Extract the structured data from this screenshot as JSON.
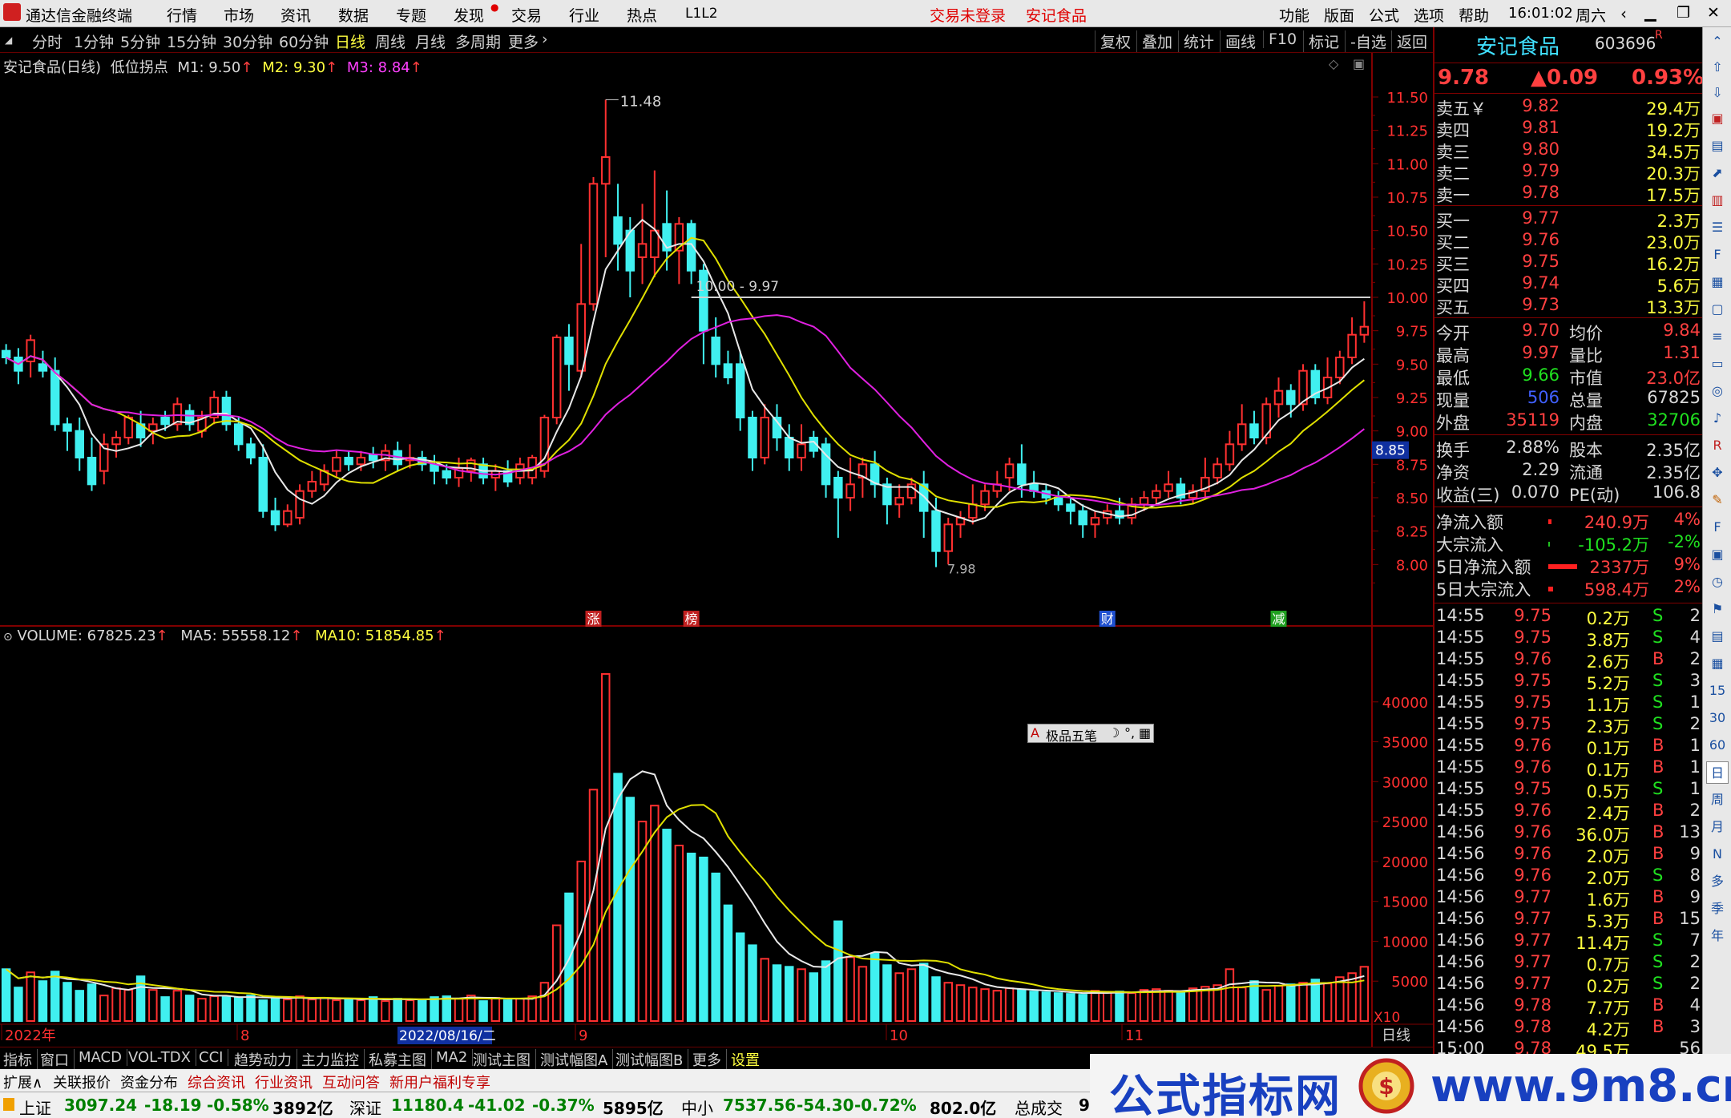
{
  "titlebar": {
    "app": "通达信金融终端",
    "menu": [
      "行情",
      "市场",
      "资讯",
      "数据",
      "专题",
      "发现",
      "交易",
      "行业",
      "热点",
      "L1L2"
    ],
    "trade_status": "交易未登录",
    "stock_name": "安记食品",
    "right_menu": [
      "功能",
      "版面",
      "公式",
      "选项",
      "帮助"
    ],
    "time": "16:01:02",
    "weekday": "周六"
  },
  "periods": [
    "分时",
    "1分钟",
    "5分钟",
    "15分钟",
    "30分钟",
    "60分钟",
    "日线",
    "周线",
    "月线",
    "多周期",
    "更多"
  ],
  "tools": [
    "复权",
    "叠加",
    "统计",
    "画线",
    "F10",
    "标记",
    "-自选",
    "返回"
  ],
  "kline_info": {
    "name": "安记食品(日线)",
    "indicator": "低位拐点",
    "m1": "M1: 9.50",
    "m2": "M2: 9.30",
    "m3": "M3: 8.84"
  },
  "volume_info": {
    "volume": "VOLUME: 67825.23",
    "ma5": "MA5: 55558.12",
    "ma10": "MA10: 51854.85"
  },
  "price_axis": [
    "11.50",
    "11.25",
    "11.00",
    "10.75",
    "10.50",
    "10.25",
    "10.00",
    "9.75",
    "9.50",
    "9.25",
    "9.00",
    "8.75",
    "8.50",
    "8.25",
    "8.00"
  ],
  "price_tag": "8.85",
  "vol_axis": [
    "40000",
    "35000",
    "30000",
    "25000",
    "20000",
    "15000",
    "10000",
    "5000"
  ],
  "vol_unit": "X10",
  "annotations": {
    "high": "11.48",
    "low": "7.98",
    "line": "10.00 - 9.97"
  },
  "markers": [
    "涨",
    "榜",
    "财",
    "减"
  ],
  "date_axis": {
    "start": "2022年",
    "m8": "8",
    "current": "2022/08/16/二",
    "m9": "9",
    "m10": "10",
    "m11": "11",
    "period": "日线"
  },
  "ime": "极品五笔",
  "chart_data": {
    "type": "candlestick",
    "ylim": [
      8.0,
      11.5
    ],
    "series": [
      "K线",
      "M1",
      "M2",
      "M3",
      "VOLUME",
      "MA5",
      "MA10"
    ],
    "candles": [
      [
        9.6,
        9.55,
        9.65,
        9.5
      ],
      [
        9.55,
        9.45,
        9.62,
        9.35
      ],
      [
        9.52,
        9.68,
        9.72,
        9.4
      ],
      [
        9.5,
        9.45,
        9.6,
        9.4
      ],
      [
        9.45,
        9.05,
        9.55,
        9.0
      ],
      [
        9.05,
        9.0,
        9.1,
        8.85
      ],
      [
        9.0,
        8.8,
        9.1,
        8.7
      ],
      [
        8.8,
        8.6,
        8.95,
        8.55
      ],
      [
        8.7,
        8.9,
        8.98,
        8.6
      ],
      [
        8.9,
        8.95,
        9.0,
        8.8
      ],
      [
        8.95,
        9.1,
        9.12,
        8.9
      ],
      [
        9.05,
        8.95,
        9.15,
        8.88
      ],
      [
        9.0,
        9.05,
        9.1,
        8.9
      ],
      [
        9.1,
        9.05,
        9.15,
        9.0
      ],
      [
        9.05,
        9.2,
        9.25,
        9.0
      ],
      [
        9.15,
        9.05,
        9.2,
        9.0
      ],
      [
        9.0,
        9.1,
        9.15,
        8.95
      ],
      [
        9.1,
        9.25,
        9.3,
        9.05
      ],
      [
        9.25,
        9.05,
        9.3,
        9.0
      ],
      [
        9.05,
        8.9,
        9.1,
        8.85
      ],
      [
        8.9,
        8.8,
        8.95,
        8.75
      ],
      [
        8.8,
        8.4,
        8.9,
        8.35
      ],
      [
        8.4,
        8.3,
        8.5,
        8.25
      ],
      [
        8.3,
        8.4,
        8.45,
        8.28
      ],
      [
        8.35,
        8.55,
        8.6,
        8.3
      ],
      [
        8.55,
        8.62,
        8.7,
        8.5
      ],
      [
        8.6,
        8.7,
        8.75,
        8.55
      ],
      [
        8.7,
        8.8,
        8.85,
        8.65
      ],
      [
        8.8,
        8.75,
        8.85,
        8.7
      ],
      [
        8.75,
        8.8,
        8.85,
        8.7
      ],
      [
        8.82,
        8.78,
        8.88,
        8.72
      ],
      [
        8.78,
        8.85,
        8.9,
        8.7
      ],
      [
        8.85,
        8.75,
        8.92,
        8.7
      ],
      [
        8.78,
        8.8,
        8.9,
        8.72
      ],
      [
        8.8,
        8.75,
        8.85,
        8.7
      ],
      [
        8.75,
        8.7,
        8.82,
        8.6
      ],
      [
        8.7,
        8.65,
        8.75,
        8.6
      ],
      [
        8.65,
        8.72,
        8.8,
        8.58
      ],
      [
        8.7,
        8.78,
        8.8,
        8.62
      ],
      [
        8.75,
        8.65,
        8.8,
        8.6
      ],
      [
        8.65,
        8.7,
        8.75,
        8.55
      ],
      [
        8.7,
        8.62,
        8.78,
        8.58
      ],
      [
        8.65,
        8.75,
        8.8,
        8.6
      ],
      [
        8.65,
        8.8,
        8.82,
        8.6
      ],
      [
        8.7,
        9.1,
        9.12,
        8.65
      ],
      [
        9.1,
        9.7,
        9.72,
        9.05
      ],
      [
        9.7,
        9.5,
        9.8,
        9.3
      ],
      [
        9.45,
        9.95,
        10.4,
        9.4
      ],
      [
        9.95,
        10.85,
        10.9,
        9.9
      ],
      [
        10.85,
        11.05,
        11.48,
        10.3
      ],
      [
        10.6,
        10.4,
        10.85,
        10.2
      ],
      [
        10.5,
        10.2,
        10.6,
        10.0
      ],
      [
        10.3,
        10.4,
        10.7,
        10.1
      ],
      [
        10.3,
        10.5,
        10.95,
        10.15
      ],
      [
        10.55,
        10.35,
        10.8,
        10.2
      ],
      [
        10.35,
        10.55,
        10.6,
        10.1
      ],
      [
        10.55,
        10.2,
        10.58,
        10.1
      ],
      [
        10.2,
        9.75,
        10.25,
        9.5
      ],
      [
        9.7,
        9.5,
        9.85,
        9.4
      ],
      [
        9.5,
        9.4,
        9.6,
        9.35
      ],
      [
        9.5,
        9.1,
        9.6,
        9.0
      ],
      [
        9.1,
        8.8,
        9.15,
        8.7
      ],
      [
        8.8,
        9.1,
        9.2,
        8.75
      ],
      [
        9.1,
        8.95,
        9.2,
        8.85
      ],
      [
        8.95,
        8.8,
        9.05,
        8.7
      ],
      [
        8.8,
        8.9,
        9.05,
        8.7
      ],
      [
        8.95,
        8.85,
        9.0,
        8.8
      ],
      [
        8.9,
        8.6,
        8.95,
        8.5
      ],
      [
        8.65,
        8.5,
        8.7,
        8.2
      ],
      [
        8.5,
        8.6,
        8.8,
        8.4
      ],
      [
        8.65,
        8.75,
        8.8,
        8.5
      ],
      [
        8.75,
        8.6,
        8.85,
        8.5
      ],
      [
        8.6,
        8.45,
        8.65,
        8.3
      ],
      [
        8.45,
        8.5,
        8.6,
        8.35
      ],
      [
        8.5,
        8.6,
        8.65,
        8.45
      ],
      [
        8.6,
        8.4,
        8.7,
        8.2
      ],
      [
        8.4,
        8.1,
        8.5,
        7.98
      ],
      [
        8.1,
        8.3,
        8.35,
        8.0
      ],
      [
        8.3,
        8.35,
        8.4,
        8.2
      ],
      [
        8.35,
        8.45,
        8.6,
        8.3
      ],
      [
        8.45,
        8.55,
        8.6,
        8.4
      ],
      [
        8.55,
        8.6,
        8.7,
        8.5
      ],
      [
        8.65,
        8.75,
        8.8,
        8.55
      ],
      [
        8.75,
        8.6,
        8.9,
        8.5
      ],
      [
        8.6,
        8.55,
        8.7,
        8.5
      ],
      [
        8.55,
        8.5,
        8.6,
        8.45
      ],
      [
        8.5,
        8.45,
        8.55,
        8.4
      ],
      [
        8.45,
        8.4,
        8.5,
        8.3
      ],
      [
        8.4,
        8.3,
        8.45,
        8.2
      ],
      [
        8.3,
        8.35,
        8.4,
        8.2
      ],
      [
        8.35,
        8.4,
        8.45,
        8.3
      ],
      [
        8.4,
        8.35,
        8.5,
        8.3
      ],
      [
        8.35,
        8.45,
        8.5,
        8.3
      ],
      [
        8.45,
        8.5,
        8.55,
        8.4
      ],
      [
        8.5,
        8.55,
        8.6,
        8.45
      ],
      [
        8.55,
        8.6,
        8.7,
        8.5
      ],
      [
        8.6,
        8.5,
        8.65,
        8.45
      ],
      [
        8.5,
        8.55,
        8.6,
        8.45
      ],
      [
        8.55,
        8.65,
        8.8,
        8.5
      ],
      [
        8.65,
        8.75,
        8.8,
        8.6
      ],
      [
        8.75,
        8.9,
        9.0,
        8.7
      ],
      [
        8.9,
        9.05,
        9.2,
        8.85
      ],
      [
        9.05,
        8.95,
        9.15,
        8.9
      ],
      [
        8.95,
        9.2,
        9.25,
        8.9
      ],
      [
        9.2,
        9.3,
        9.4,
        9.1
      ],
      [
        9.3,
        9.2,
        9.35,
        9.1
      ],
      [
        9.2,
        9.45,
        9.5,
        9.15
      ],
      [
        9.45,
        9.25,
        9.5,
        9.2
      ],
      [
        9.25,
        9.4,
        9.55,
        9.2
      ],
      [
        9.4,
        9.55,
        9.6,
        9.35
      ],
      [
        9.55,
        9.72,
        9.85,
        9.5
      ],
      [
        9.72,
        9.78,
        9.97,
        9.66
      ]
    ],
    "volume": [
      6500,
      4200,
      6100,
      5000,
      6200,
      4800,
      3800,
      4600,
      3200,
      4100,
      3900,
      5600,
      3900,
      3000,
      3800,
      3200,
      2800,
      3100,
      3000,
      2900,
      3200,
      2600,
      3000,
      2700,
      3100,
      2700,
      2900,
      2600,
      2800,
      2600,
      3000,
      2500,
      2800,
      2600,
      2700,
      3000,
      3100,
      2800,
      3200,
      2500,
      2900,
      2600,
      2800,
      3100,
      4800,
      12000,
      16000,
      20000,
      29000,
      43500,
      31000,
      28000,
      25000,
      27000,
      24000,
      22000,
      21000,
      20500,
      18500,
      14500,
      11000,
      9500,
      7800,
      7000,
      6800,
      6500,
      6000,
      7500,
      12500,
      8000,
      6800,
      8500,
      7000,
      6000,
      6500,
      7200,
      5500,
      4800,
      4500,
      4200,
      4000,
      3800,
      4100,
      3900,
      3700,
      3600,
      3500,
      3400,
      3300,
      3800,
      3600,
      3700,
      3500,
      3900,
      4000,
      3800,
      3600,
      4100,
      4300,
      4500,
      6500,
      4200,
      5000,
      3900,
      4400,
      4600,
      4800,
      5200,
      4700,
      5500,
      6000,
      6800
    ],
    "m1_values": "9.50",
    "m2_values": "9.30",
    "m3_values": "8.84"
  },
  "quote": {
    "name": "安记食品",
    "code": "603696",
    "flag": "R",
    "price": "9.78",
    "change": "▲0.09",
    "pct": "0.93%",
    "asks": [
      [
        "卖五￥",
        "9.82",
        "29.4万"
      ],
      [
        "卖四",
        "9.81",
        "19.2万"
      ],
      [
        "卖三",
        "9.80",
        "34.5万"
      ],
      [
        "卖二",
        "9.79",
        "20.3万"
      ],
      [
        "卖一",
        "9.78",
        "17.5万"
      ]
    ],
    "bids": [
      [
        "买一",
        "9.77",
        "2.3万"
      ],
      [
        "买二",
        "9.76",
        "23.0万"
      ],
      [
        "买三",
        "9.75",
        "16.2万"
      ],
      [
        "买四",
        "9.74",
        "5.6万"
      ],
      [
        "买五",
        "9.73",
        "13.3万"
      ]
    ],
    "stats": [
      [
        "今开",
        "9.70",
        "均价",
        "9.84"
      ],
      [
        "最高",
        "9.97",
        "量比",
        "1.31"
      ],
      [
        "最低",
        "9.66",
        "市值",
        "23.0亿"
      ],
      [
        "现量",
        "506",
        "总量",
        "67825"
      ],
      [
        "外盘",
        "35119",
        "内盘",
        "32706"
      ]
    ],
    "fin": [
      [
        "换手",
        "2.88%",
        "股本",
        "2.35亿"
      ],
      [
        "净资",
        "2.29",
        "流通",
        "2.35亿"
      ],
      [
        "收益(三)",
        "0.070",
        "PE(动)",
        "106.8"
      ]
    ],
    "flow": [
      [
        "净流入额",
        "240.9万",
        "4%"
      ],
      [
        "大宗流入",
        "-105.2万",
        "-2%"
      ],
      [
        "5日净流入额",
        "2337万",
        "9%"
      ],
      [
        "5日大宗流入",
        "598.4万",
        "2%"
      ]
    ],
    "ticks": [
      [
        "14:55",
        "9.75",
        "0.2万",
        "S",
        "2"
      ],
      [
        "14:55",
        "9.75",
        "3.8万",
        "S",
        "4"
      ],
      [
        "14:55",
        "9.76",
        "2.6万",
        "B",
        "2"
      ],
      [
        "14:55",
        "9.75",
        "5.2万",
        "S",
        "3"
      ],
      [
        "14:55",
        "9.75",
        "1.1万",
        "S",
        "1"
      ],
      [
        "14:55",
        "9.75",
        "2.3万",
        "S",
        "2"
      ],
      [
        "14:55",
        "9.76",
        "0.1万",
        "B",
        "1"
      ],
      [
        "14:55",
        "9.76",
        "0.1万",
        "B",
        "1"
      ],
      [
        "14:55",
        "9.75",
        "0.5万",
        "S",
        "1"
      ],
      [
        "14:55",
        "9.76",
        "2.4万",
        "B",
        "2"
      ],
      [
        "14:56",
        "9.76",
        "36.0万",
        "B",
        "13"
      ],
      [
        "14:56",
        "9.76",
        "2.0万",
        "B",
        "9"
      ],
      [
        "14:56",
        "9.76",
        "2.0万",
        "S",
        "8"
      ],
      [
        "14:56",
        "9.77",
        "1.6万",
        "B",
        "9"
      ],
      [
        "14:56",
        "9.77",
        "5.3万",
        "B",
        "15"
      ],
      [
        "14:56",
        "9.77",
        "11.4万",
        "S",
        "7"
      ],
      [
        "14:56",
        "9.77",
        "0.7万",
        "S",
        "2"
      ],
      [
        "14:56",
        "9.77",
        "0.2万",
        "S",
        "2"
      ],
      [
        "14:56",
        "9.78",
        "7.7万",
        "B",
        "4"
      ],
      [
        "14:56",
        "9.78",
        "4.2万",
        "B",
        "3"
      ],
      [
        "15:00",
        "9.78",
        "49.5万",
        "",
        "56"
      ]
    ]
  },
  "sidebar": [
    "15",
    "30",
    "60",
    "日",
    "周",
    "月",
    "N",
    "多",
    "季",
    "年"
  ],
  "tabs": [
    "指标",
    "窗口",
    "MACD",
    "VOL-TDX",
    "CCI",
    "趋势动力",
    "主力监控",
    "私募主图",
    "MA2",
    "测试主图",
    "测试幅图A",
    "测试幅图B",
    "更多",
    "设置"
  ],
  "tabs2": [
    "扩展∧",
    "关联报价",
    "资金分布",
    "综合资讯",
    "行业资讯",
    "互动问答",
    "新用户福利专享"
  ],
  "status": {
    "sh_label": "上证",
    "sh": "3097.24",
    "sh_chg": "-18.19",
    "sh_pct": "-0.58%",
    "sh_amt": "3892亿",
    "sz_label": "深证",
    "sz": "11180.4",
    "sz_chg": "-41.02",
    "sz_pct": "-0.37%",
    "sz_amt": "5895亿",
    "zx_label": "中小",
    "zx": "7537.56",
    "zx_chg": "-54.30",
    "zx_pct": "-0.72%",
    "zx_amt": "802.0亿",
    "total": "总成交",
    "total_v": "9"
  },
  "watermark": {
    "left": "公式指标网",
    "right": "www.9m8.cn"
  },
  "colors": {
    "up": "#ff3030",
    "down": "#40f0f0",
    "ma_white": "#e8e8e8",
    "ma_yellow": "#e0e000",
    "ma_magenta": "#e020e0",
    "grid": "#800000"
  }
}
